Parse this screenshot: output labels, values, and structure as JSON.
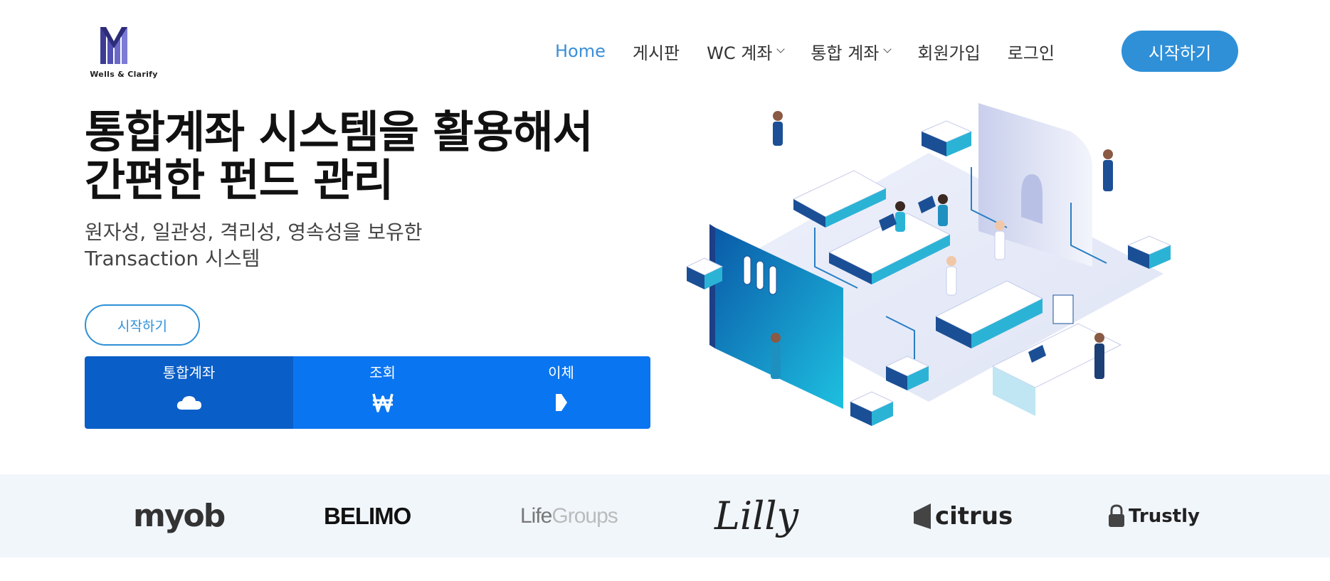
{
  "brand": {
    "logo_text": "Wells & Clarify",
    "logo_color": "#4a49a8"
  },
  "nav": {
    "home": "Home",
    "board": "게시판",
    "wc_account": "WC 계좌",
    "integrated_account": "통합 계좌",
    "signup": "회원가입",
    "login": "로그인",
    "cta": "시작하기"
  },
  "hero": {
    "title_line1": "통합계좌 시스템을 활용해서",
    "title_line2": "간편한 펀드 관리",
    "subtitle_line1": "원자성, 일관성, 격리성, 영속성을 보유한",
    "subtitle_line2": "Transaction 시스템",
    "button": "시작하기"
  },
  "tabs": [
    {
      "label": "통합계좌",
      "icon": "cloud-icon",
      "active": true
    },
    {
      "label": "조회",
      "icon": "won-icon",
      "active": false
    },
    {
      "label": "이체",
      "icon": "arrow-right-icon",
      "active": false
    }
  ],
  "partners": {
    "myob": "myob",
    "belimo": "BELIMO",
    "life": "Life",
    "groups": "Groups",
    "lilly": "Lilly",
    "citrus": "citrus",
    "trustly": "Trustly"
  },
  "colors": {
    "accent": "#2f90d8",
    "tab_blue": "#0a75f0",
    "tab_active": "#0a5ec7",
    "band_bg": "#f1f6fb"
  }
}
